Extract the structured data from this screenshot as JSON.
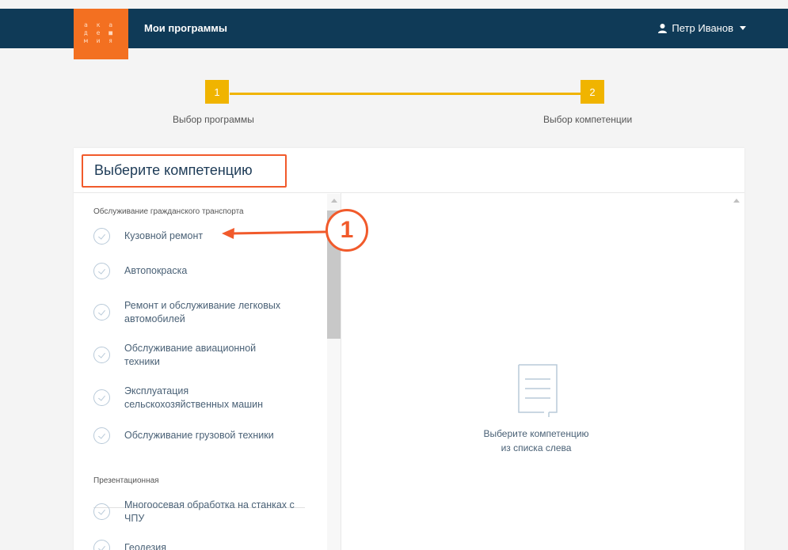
{
  "header": {
    "logo_lines": [
      "а к а",
      "д е ■",
      "м и я"
    ],
    "title": "Мои программы",
    "user_name": "Петр Иванов"
  },
  "stepper": {
    "steps": [
      {
        "number": "1",
        "label": "Выбор программы"
      },
      {
        "number": "2",
        "label": "Выбор компетенции"
      }
    ]
  },
  "card": {
    "title": "Выберите компетенцию"
  },
  "groups": [
    {
      "title": "Обслуживание гражданского транспорта",
      "items": [
        "Кузовной ремонт",
        "Автопокраска",
        "Ремонт и обслуживание легковых автомобилей",
        "Обслуживание авиационной техники",
        "Эксплуатация сельскохозяйственных машин",
        "Обслуживание грузовой техники"
      ]
    },
    {
      "title": "Презентационная",
      "items": [
        "Многоосевая обработка на станках с ЧПУ",
        "Геодезия"
      ]
    }
  ],
  "empty_state": {
    "line1": "Выберите компетенцию",
    "line2": "из списка слева"
  },
  "annotation": {
    "marker": "1"
  },
  "colors": {
    "header_bg": "#0f3a57",
    "logo_bg": "#f37021",
    "step_accent": "#f0b400",
    "annotation": "#f15a2b"
  },
  "icons": [
    "user-icon",
    "caret-down-icon",
    "check-circle-icon",
    "document-icon",
    "scroll-up-icon"
  ]
}
